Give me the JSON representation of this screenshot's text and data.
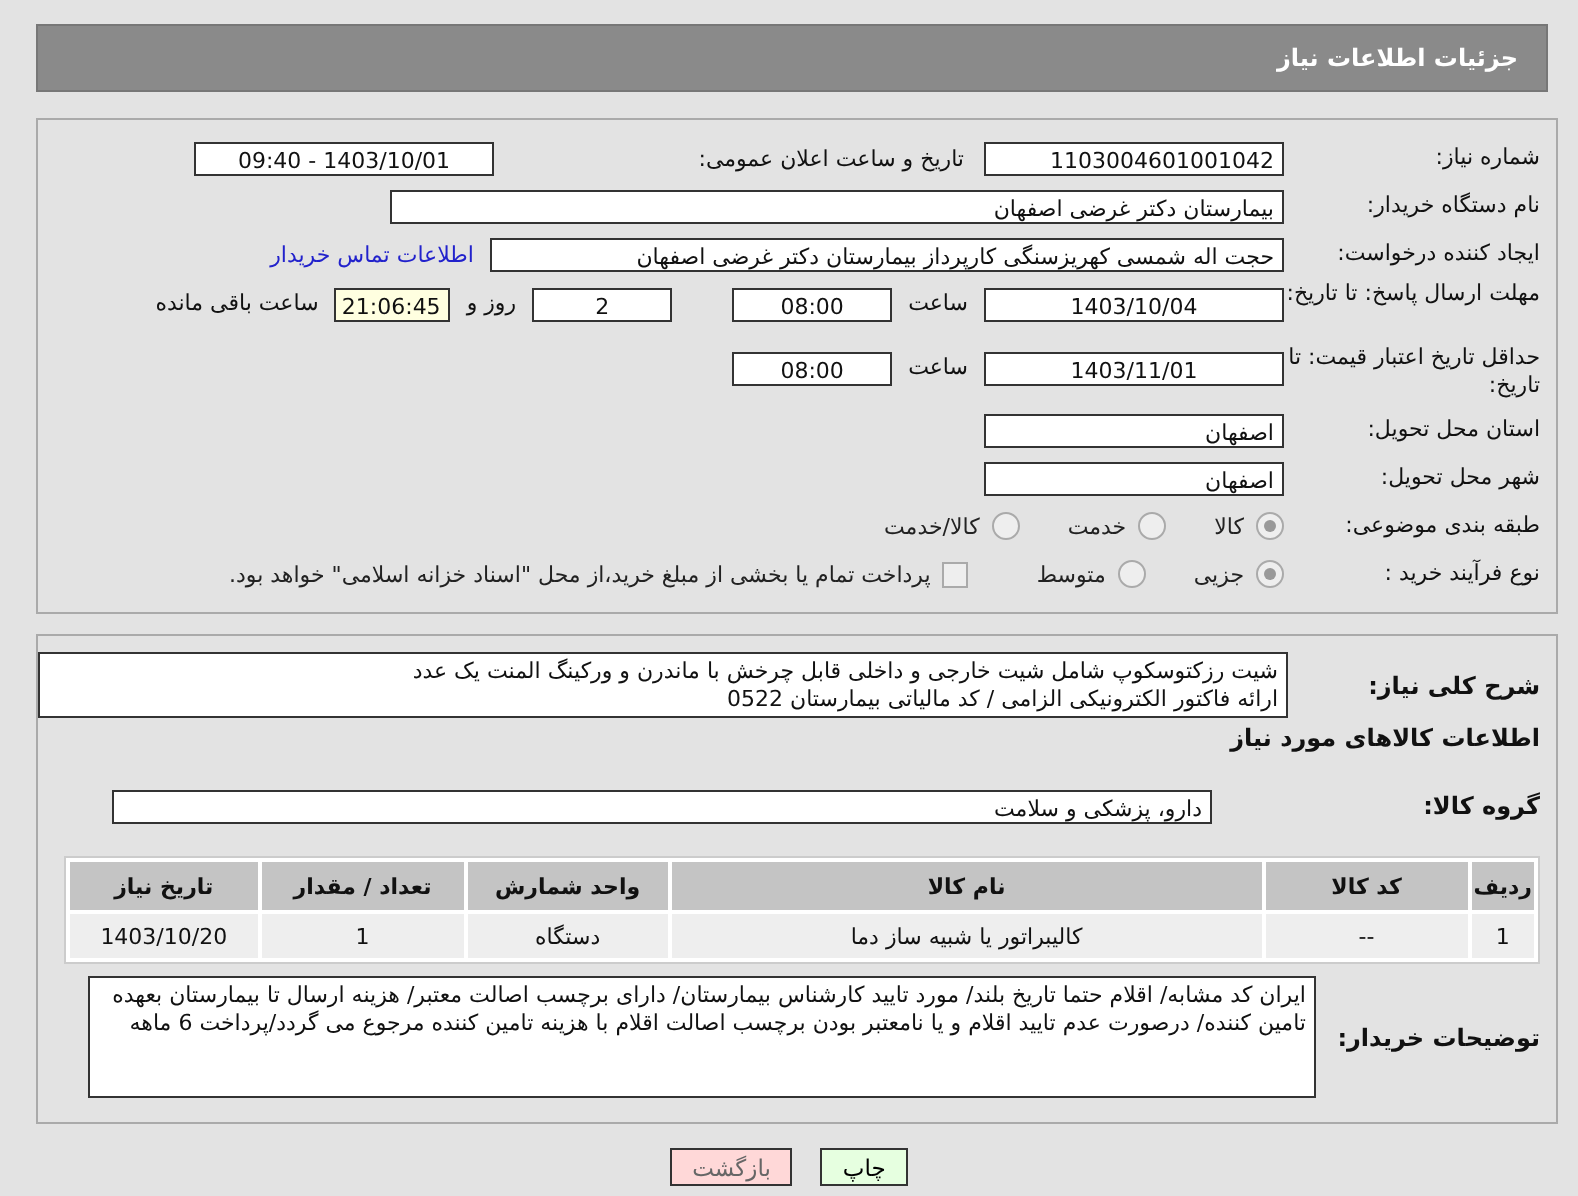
{
  "header": {
    "title": "جزئیات اطلاعات نیاز"
  },
  "need_number": {
    "label": "شماره نیاز:",
    "value": "1103004601001042"
  },
  "announce": {
    "label": "تاریخ و ساعت اعلان عمومی:",
    "value": "1403/10/01 - 09:40"
  },
  "buyer_org": {
    "label": "نام دستگاه خریدار:",
    "value": "بیمارستان دکتر غرضی اصفهان"
  },
  "requester": {
    "label": "ایجاد کننده درخواست:",
    "value": "حجت اله شمسی کهریزسنگی کارپرداز بیمارستان دکتر غرضی اصفهان",
    "link": "اطلاعات تماس خریدار"
  },
  "reply_deadline": {
    "label": "مهلت ارسال پاسخ: تا تاریخ:",
    "date": "1403/10/04",
    "time_label": "ساعت",
    "time": "08:00",
    "days": "2",
    "days_label": "روز و",
    "remaining": "21:06:45",
    "remaining_label": "ساعت باقی مانده"
  },
  "validity_deadline": {
    "label": "حداقل تاریخ اعتبار قیمت: تا تاریخ:",
    "date": "1403/11/01",
    "time_label": "ساعت",
    "time": "08:00"
  },
  "province": {
    "label": "استان محل تحویل:",
    "value": "اصفهان"
  },
  "city": {
    "label": "شهر محل تحویل:",
    "value": "اصفهان"
  },
  "category": {
    "label": "طبقه بندی موضوعی:",
    "options": [
      {
        "label": "کالا",
        "selected": true
      },
      {
        "label": "خدمت",
        "selected": false
      },
      {
        "label": "کالا/خدمت",
        "selected": false
      }
    ]
  },
  "process": {
    "label": "نوع فرآیند خرید :",
    "options": [
      {
        "label": "جزیی",
        "selected": true
      },
      {
        "label": "متوسط",
        "selected": false
      }
    ],
    "treasury": {
      "label": "پرداخت تمام یا بخشی از مبلغ خرید،از محل \"اسناد خزانه اسلامی\" خواهد بود.",
      "checked": false
    }
  },
  "description": {
    "label": "شرح کلی نیاز:",
    "value": "شیت رزکتوسکوپ شامل شیت خارجی و داخلی قابل چرخش با ماندرن و ورکینگ المنت یک عدد\nارائه فاکتور الکترونیکی الزامی / کد مالیاتی بیمارستان 0522"
  },
  "goods_title": "اطلاعات کالاهای مورد نیاز",
  "goods_group": {
    "label": "گروه کالا:",
    "value": "دارو، پزشکی و سلامت"
  },
  "table": {
    "columns": [
      "ردیف",
      "کد کالا",
      "نام کالا",
      "واحد شمارش",
      "تعداد / مقدار",
      "تاریخ نیاز"
    ],
    "rows": [
      [
        "1",
        "--",
        "کالیبراتور یا شبیه ساز دما",
        "دستگاه",
        "1",
        "1403/10/20"
      ]
    ]
  },
  "buyer_notes": {
    "label": "توضیحات خریدار:",
    "value": "ایران کد مشابه/ اقلام حتما تاریخ بلند/ مورد تایید کارشناس بیمارستان/ دارای برچسب اصالت معتبر/ هزینه ارسال تا بیمارستان بعهده تامین کننده/ درصورت عدم تایید اقلام و یا نامعتبر بودن برچسب اصالت اقلام با هزینه تامین کننده مرجوع می گردد/پرداخت 6 ماهه"
  },
  "buttons": [
    {
      "kind": "print",
      "label": "چاپ"
    },
    {
      "kind": "back",
      "label": "بازگشت"
    }
  ]
}
